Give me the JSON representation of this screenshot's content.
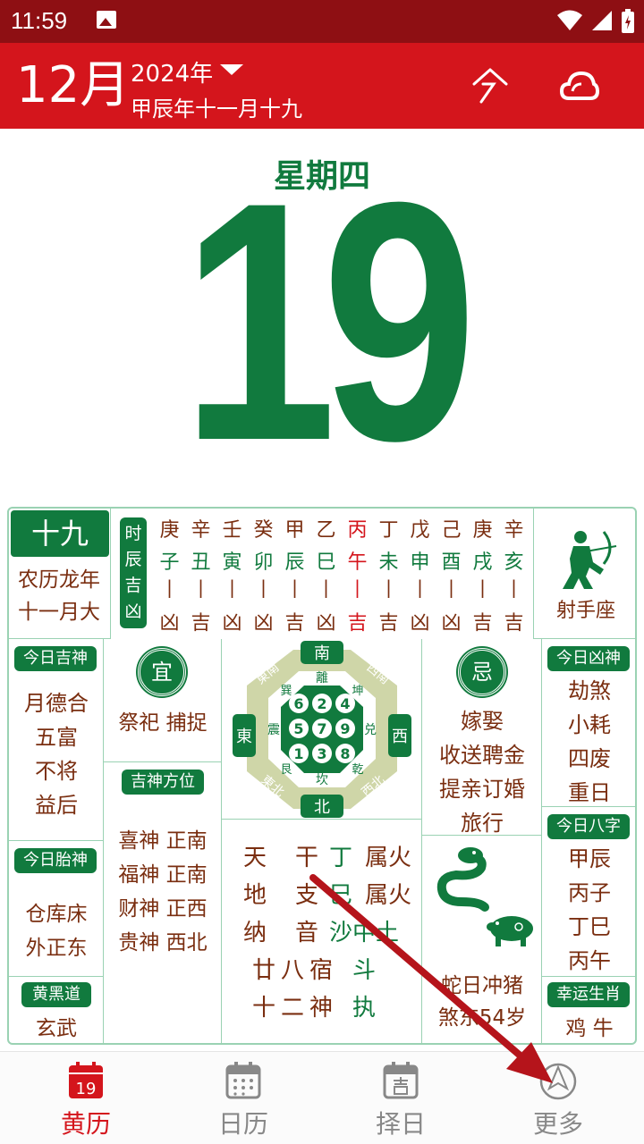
{
  "status": {
    "time": "11:59"
  },
  "header": {
    "month": "12月",
    "year": "2024年",
    "lunar_date": "甲辰年十一月十九"
  },
  "day": {
    "weekday": "星期四",
    "number": "19"
  },
  "lunar_box": {
    "day": "十九",
    "line1": "农历龙年",
    "line2": "十一月大"
  },
  "shichen": {
    "label": [
      "时",
      "辰",
      "吉",
      "凶"
    ],
    "columns": [
      {
        "top": "庚",
        "mid": "子",
        "fate": "凶"
      },
      {
        "top": "辛",
        "mid": "丑",
        "fate": "吉"
      },
      {
        "top": "壬",
        "mid": "寅",
        "fate": "凶"
      },
      {
        "top": "癸",
        "mid": "卯",
        "fate": "凶"
      },
      {
        "top": "甲",
        "mid": "辰",
        "fate": "吉"
      },
      {
        "top": "乙",
        "mid": "巳",
        "fate": "凶"
      },
      {
        "top": "丙",
        "mid": "午",
        "fate": "吉"
      },
      {
        "top": "丁",
        "mid": "未",
        "fate": "吉"
      },
      {
        "top": "戊",
        "mid": "申",
        "fate": "凶"
      },
      {
        "top": "己",
        "mid": "酉",
        "fate": "凶"
      },
      {
        "top": "庚",
        "mid": "戌",
        "fate": "吉"
      },
      {
        "top": "辛",
        "mid": "亥",
        "fate": "吉"
      }
    ],
    "sep": "|"
  },
  "zodiac_sign": "射手座",
  "jishen": {
    "title": "今日吉神",
    "items": [
      "月德合",
      "五富",
      "不将",
      "益后"
    ]
  },
  "yi": {
    "badge": "宜",
    "text": "祭祀 捕捉"
  },
  "ji": {
    "badge": "忌",
    "items": [
      "嫁娶",
      "收送聘金",
      "提亲订婚",
      "旅行"
    ]
  },
  "xiongshen": {
    "title": "今日凶神",
    "items": [
      "劫煞",
      "小耗",
      "四废",
      "重日"
    ]
  },
  "taishen": {
    "title": "今日胎神",
    "items": [
      "仓库床",
      "外正东"
    ]
  },
  "fangwei": {
    "title": "吉神方位",
    "items": [
      "喜神 正南",
      "福神 正南",
      "财神 正西",
      "贵神 西北"
    ]
  },
  "huangheidao": {
    "title": "黄黑道",
    "value": "玄武"
  },
  "bazi": {
    "title": "今日八字",
    "items": [
      "甲辰",
      "丙子",
      "丁巳",
      "丙午"
    ]
  },
  "lucky": {
    "title": "幸运生肖",
    "value": "鸡 牛"
  },
  "bagua": {
    "south": "南",
    "north": "北",
    "east": "東",
    "west": "西",
    "se": "東南",
    "sw": "西南",
    "ne": "東北",
    "nw": "西北",
    "li": "離",
    "kan": "坎",
    "zhen": "震",
    "dui": "兑",
    "xun": "巽",
    "kun": "坤",
    "gen": "艮",
    "qian": "乾",
    "nums": [
      "6",
      "2",
      "4",
      "5",
      "7",
      "9",
      "1",
      "3",
      "8"
    ]
  },
  "ganzhi": {
    "rows": [
      {
        "k": "天",
        "v": "干",
        "g": "丁",
        "e": "属火"
      },
      {
        "k": "地",
        "v": "支",
        "g": "巳",
        "e": "属火"
      },
      {
        "k": "纳",
        "v": "音",
        "g": "沙中土",
        "e": ""
      },
      {
        "k": "廿八宿",
        "v": "",
        "g": "斗",
        "e": ""
      },
      {
        "k": "十二神",
        "v": "",
        "g": "执",
        "e": ""
      }
    ]
  },
  "chong": {
    "line1": "蛇日冲猪",
    "line2": "煞东54岁"
  },
  "tabs": [
    "黄历",
    "日历",
    "择日",
    "更多"
  ],
  "tab_icon_day": "19",
  "colors": {
    "red": "#d4151c",
    "green": "#117a3e",
    "brown": "#7a2e10"
  }
}
